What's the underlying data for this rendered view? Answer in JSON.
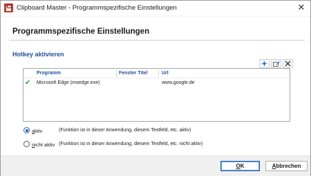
{
  "window": {
    "title": "Clipboard Master - Programmspezifische Einstellungen",
    "close_glyph": "✕"
  },
  "page": {
    "title": "Programmspezifische Einstellungen",
    "section_title": "Hotkey aktivieren"
  },
  "toolbar": {
    "buttons": [
      {
        "icon": "add-icon"
      },
      {
        "icon": "edit-icon"
      },
      {
        "icon": "delete-icon"
      }
    ]
  },
  "table": {
    "columns": [
      "Programm",
      "Fenster Titel",
      "Url"
    ],
    "rows": [
      {
        "checked": true,
        "check_glyph": "✔",
        "program": "Microsoft Edge    (msedge.exe)",
        "window_title": "",
        "url": "www.google.de"
      }
    ]
  },
  "options": {
    "active": {
      "label_first": "a",
      "label_rest": "ktiv",
      "description": "(Funktion ist in dieser Anwendung, diesem Textfeld, etc. aktiv)",
      "selected": true
    },
    "inactive": {
      "label_first": "n",
      "label_rest": "icht aktiv",
      "description": "(Funktion ist in dieser Anwendung, diesem Textfeld, etc. nicht aktiv)",
      "selected": false
    }
  },
  "buttons": {
    "ok_first": "O",
    "ok_rest": "K",
    "cancel_first": "A",
    "cancel_rest": "bbrechen"
  },
  "colors": {
    "section_blue": "#1e4f9c",
    "check_green": "#2e9a2e",
    "radio_blue": "#1a5fb4"
  }
}
